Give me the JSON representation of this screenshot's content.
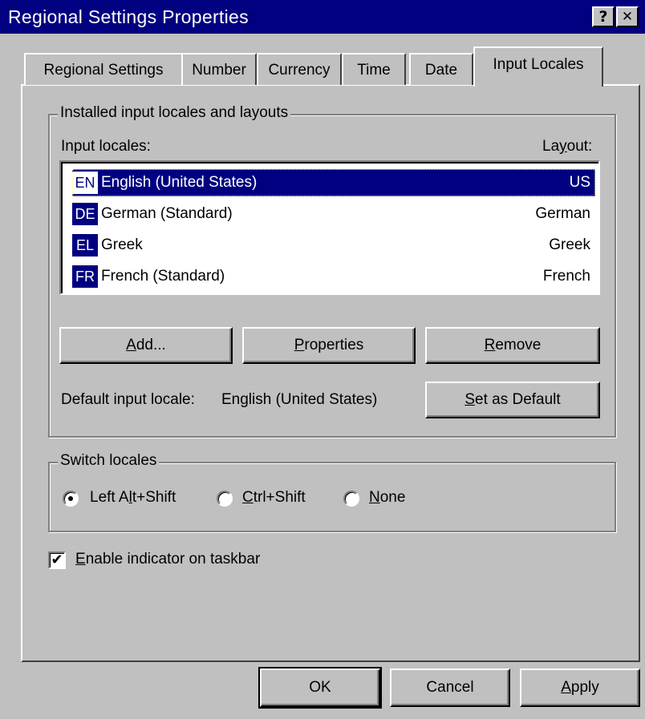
{
  "window": {
    "title": "Regional Settings Properties",
    "help_glyph": "?",
    "close_glyph": "✕"
  },
  "tabs": [
    {
      "label": "Regional Settings",
      "active": false
    },
    {
      "label": "Number",
      "active": false
    },
    {
      "label": "Currency",
      "active": false
    },
    {
      "label": "Time",
      "active": false
    },
    {
      "label": "Date",
      "active": false
    },
    {
      "label": "Input Locales",
      "active": true
    }
  ],
  "installed_group": {
    "legend": "Installed input locales and layouts",
    "col_locales": "Input locales:",
    "col_layout_pre": "La",
    "col_layout_key": "y",
    "col_layout_post": "out:",
    "locales": [
      {
        "code": "EN",
        "name": "English (United States)",
        "layout": "US",
        "selected": true
      },
      {
        "code": "DE",
        "name": "German (Standard)",
        "layout": "German",
        "selected": false
      },
      {
        "code": "EL",
        "name": "Greek",
        "layout": "Greek",
        "selected": false
      },
      {
        "code": "FR",
        "name": "French (Standard)",
        "layout": "French",
        "selected": false
      }
    ],
    "add_key": "A",
    "add_rest": "dd...",
    "properties_key": "P",
    "properties_rest": "roperties",
    "remove_key": "R",
    "remove_rest": "emove",
    "default_label": "Default input locale:",
    "default_value": "English (United States)",
    "set_default_key": "S",
    "set_default_rest": "et as Default"
  },
  "switch_group": {
    "legend": "Switch locales",
    "option1_pre": "Left A",
    "option1_key": "l",
    "option1_post": "t+Shift",
    "option2_key": "C",
    "option2_rest": "trl+Shift",
    "option3_key": "N",
    "option3_rest": "one",
    "selected_option": "Left Alt+Shift"
  },
  "indicator": {
    "checked": true,
    "check_glyph": "✔",
    "label_key": "E",
    "label_rest": "nable indicator on taskbar"
  },
  "footer": {
    "ok": "OK",
    "cancel": "Cancel",
    "apply_key": "A",
    "apply_rest": "pply"
  },
  "colors": {
    "face": "#c0c0c0",
    "title_bar": "#000080",
    "selection": "#000080"
  }
}
